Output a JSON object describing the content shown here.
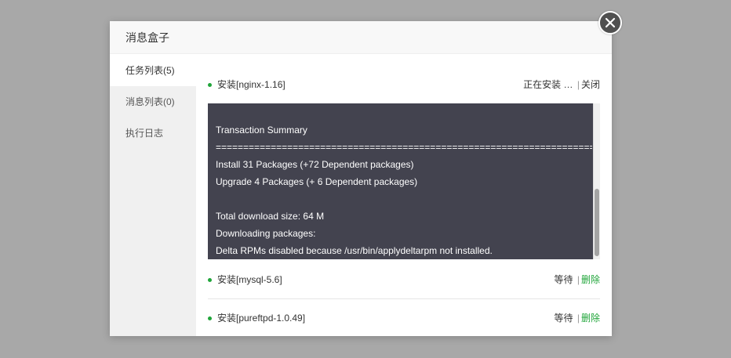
{
  "dialog": {
    "title": "消息盒子"
  },
  "sidebar": {
    "items": [
      {
        "label": "任务列表(5)",
        "active": true
      },
      {
        "label": "消息列表(0)",
        "active": false
      },
      {
        "label": "执行日志",
        "active": false
      }
    ]
  },
  "tasks": [
    {
      "name": "安装[nginx-1.16]",
      "status": "正在安装 …",
      "action": "关闭"
    },
    {
      "name": "安装[mysql-5.6]",
      "status": "等待",
      "action": "删除"
    },
    {
      "name": "安装[pureftpd-1.0.49]",
      "status": "等待",
      "action": "删除"
    }
  ],
  "terminal": {
    "lines": [
      "Transaction Summary",
      "================================================================================================",
      "Install 31 Packages (+72 Dependent packages)",
      "Upgrade 4 Packages (+ 6 Dependent packages)",
      "",
      "Total download size: 64 M",
      "Downloading packages:",
      "Delta RPMs disabled because /usr/bin/applydeltarpm not installed."
    ],
    "scroll_position_fraction": 0.88
  },
  "colors": {
    "accent": "#20a53a",
    "terminal_bg": "#43434f",
    "backdrop": "#a8a8a8"
  }
}
